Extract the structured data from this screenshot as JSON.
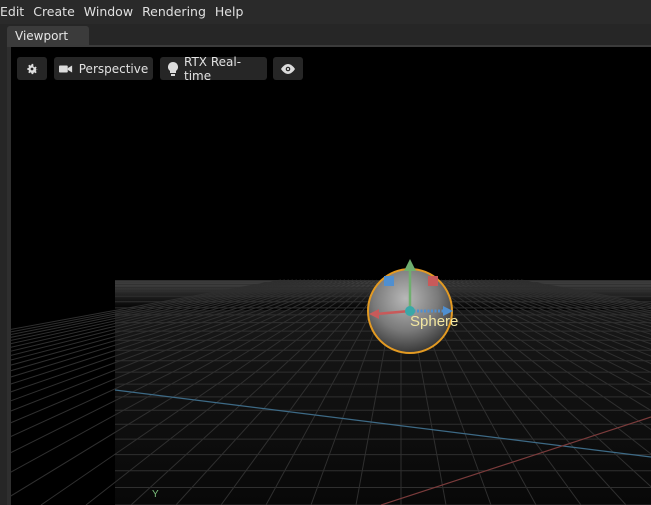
{
  "menubar": {
    "items": [
      "Edit",
      "Create",
      "Window",
      "Rendering",
      "Help"
    ]
  },
  "tabs": {
    "active_label": "Viewport"
  },
  "viewport_toolbar": {
    "settings_icon": "gear-icon",
    "camera_icon": "camera-icon",
    "camera_label": "Perspective",
    "renderer_icon": "lightbulb-icon",
    "renderer_label": "RTX Real-time",
    "visibility_icon": "eye-icon"
  },
  "scene": {
    "selected_object_label": "Sphere",
    "axis_label": "Y"
  },
  "colors": {
    "gizmo_x": "#c85a5a",
    "gizmo_y": "#6fae6f",
    "gizmo_z": "#4f8fd0",
    "selection_outline": "#e39a22",
    "label_yellow": "#f2e6a0"
  }
}
